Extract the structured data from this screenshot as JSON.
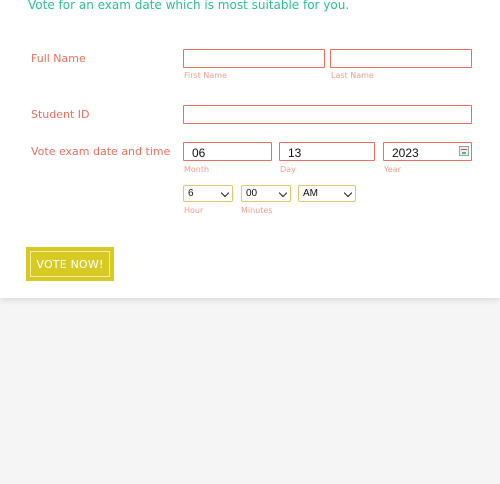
{
  "intro_text": "Vote for an exam date which is most suitable for you.",
  "full_name": {
    "label": "Full Name",
    "first_value": "",
    "last_value": "",
    "first_sublabel": "First Name",
    "last_sublabel": "Last Name"
  },
  "student_id": {
    "label": "Student ID",
    "value": ""
  },
  "exam_date": {
    "label": "Vote exam date and time",
    "month_value": "06",
    "day_value": "13",
    "year_value": "2023",
    "month_sublabel": "Month",
    "day_sublabel": "Day",
    "year_sublabel": "Year",
    "calendar_icon": "calendar-icon"
  },
  "exam_time": {
    "hour_value": "6",
    "minutes_value": "00",
    "ampm_value": "AM",
    "hour_sublabel": "Hour",
    "minutes_sublabel": "Minutes"
  },
  "submit_label": "VOTE NOW!",
  "colors": {
    "accent_label": "#e8705f",
    "intro": "#2bbf94",
    "button": "#d7ca25",
    "select_border": "#e8c56a",
    "background": "#f5f5f5"
  }
}
